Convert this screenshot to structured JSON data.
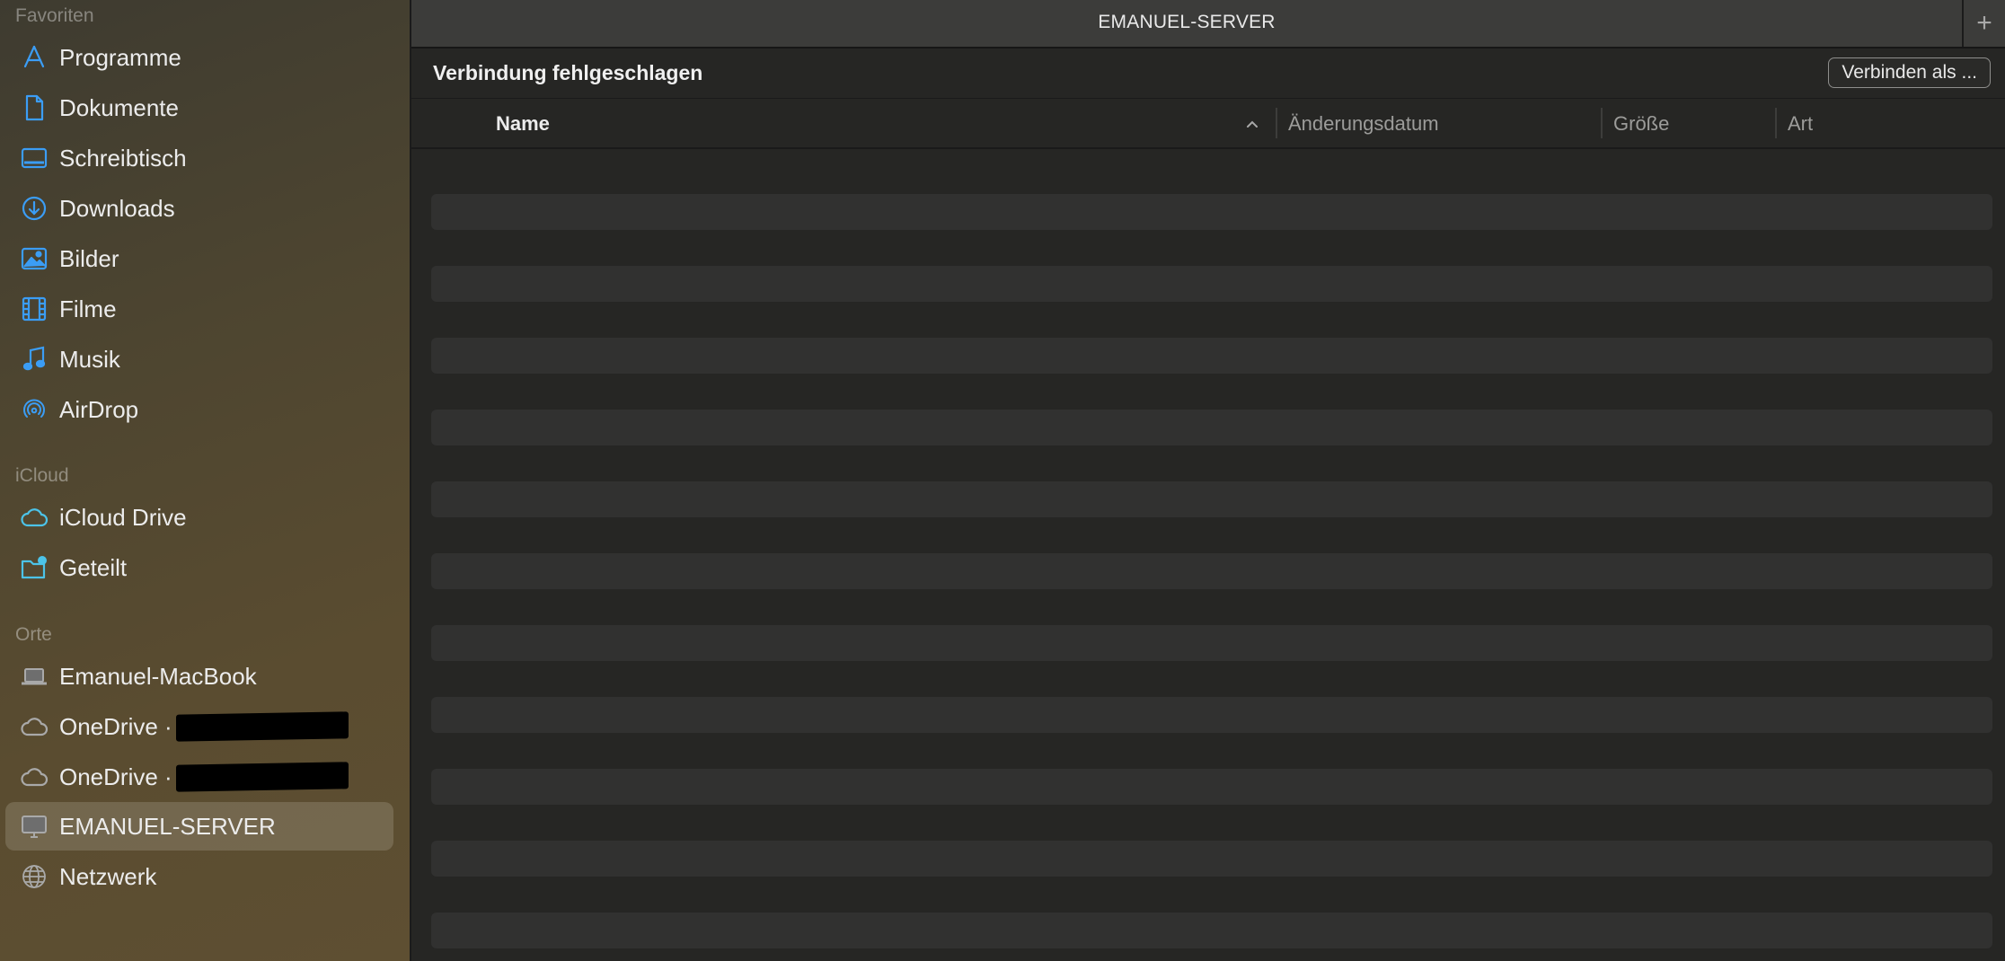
{
  "window": {
    "title": "EMANUEL-SERVER",
    "new_tab_glyph": "+"
  },
  "sidebar": {
    "sections": [
      {
        "title": "Favoriten"
      },
      {
        "title": "iCloud"
      },
      {
        "title": "Orte"
      }
    ],
    "favorites": [
      {
        "label": "Programme",
        "icon": "apps-icon"
      },
      {
        "label": "Dokumente",
        "icon": "document-icon"
      },
      {
        "label": "Schreibtisch",
        "icon": "desktop-icon"
      },
      {
        "label": "Downloads",
        "icon": "download-icon"
      },
      {
        "label": "Bilder",
        "icon": "photo-icon"
      },
      {
        "label": "Filme",
        "icon": "film-icon"
      },
      {
        "label": "Musik",
        "icon": "music-icon"
      },
      {
        "label": "AirDrop",
        "icon": "airdrop-icon"
      }
    ],
    "icloud": [
      {
        "label": "iCloud Drive",
        "icon": "cloud-icon"
      },
      {
        "label": "Geteilt",
        "icon": "shared-folder-icon"
      }
    ],
    "locations": [
      {
        "label": "Emanuel-MacBook",
        "icon": "laptop-icon"
      },
      {
        "label": "OneDrive ·",
        "icon": "cloud-icon"
      },
      {
        "label": "OneDrive ·",
        "icon": "cloud-icon"
      },
      {
        "label": "EMANUEL-SERVER",
        "icon": "monitor-icon",
        "selected": true
      },
      {
        "label": "Netzwerk",
        "icon": "globe-icon"
      }
    ]
  },
  "main": {
    "status": "Verbindung fehlgeschlagen",
    "connect_button": "Verbinden als ...",
    "columns": [
      {
        "label": "Name",
        "sorted": "ascending"
      },
      {
        "label": "Änderungsdatum"
      },
      {
        "label": "Größe"
      },
      {
        "label": "Art"
      }
    ]
  },
  "colors": {
    "accent_blue": "#3b9df5",
    "icloud_cyan": "#4cc3e8",
    "device_gray": "#a9a9a9"
  }
}
